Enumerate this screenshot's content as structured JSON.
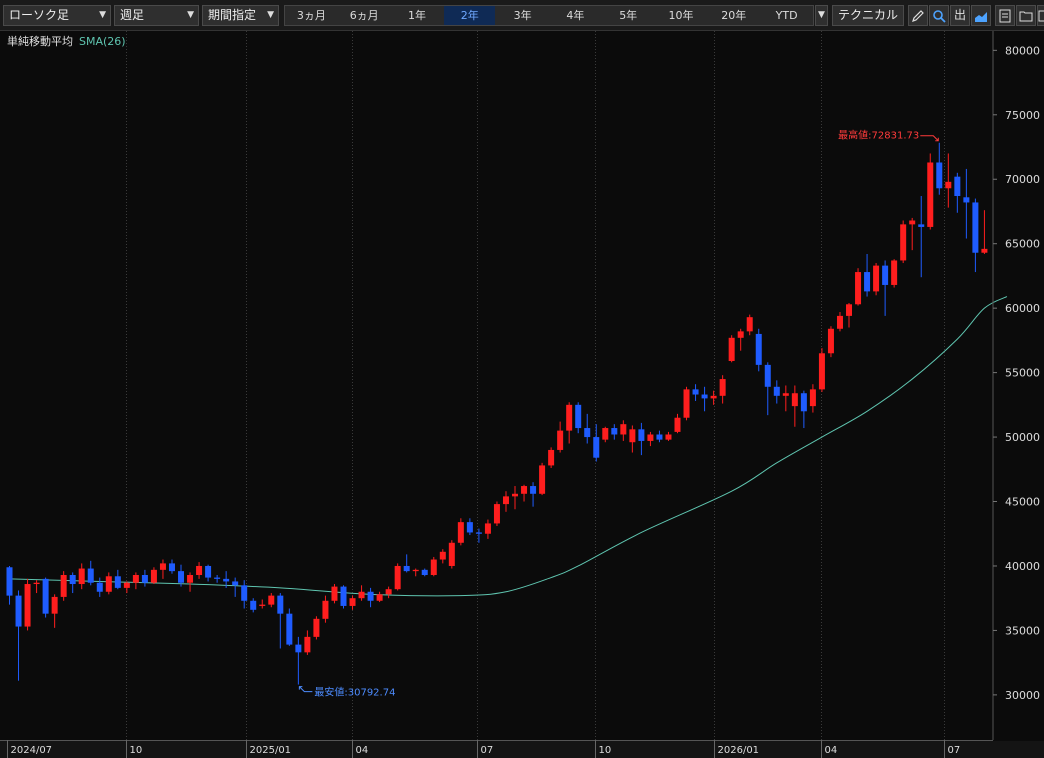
{
  "toolbar": {
    "chart_type": "ローソク足",
    "interval": "週足",
    "range_mode": "期間指定",
    "periods": [
      "3ヵ月",
      "6ヵ月",
      "1年",
      "2年",
      "3年",
      "4年",
      "5年",
      "10年",
      "20年",
      "YTD"
    ],
    "active_period": "2年",
    "technical_label": "テクニカル",
    "icons": [
      "pencil-icon",
      "zoom-icon",
      "export-icon",
      "chart-style-icon",
      "save-icon",
      "folder-icon",
      "window-icon"
    ],
    "export_glyph": "出"
  },
  "indicator": {
    "name": "単純移動平均",
    "param": "SMA(26)"
  },
  "colors": {
    "up": "#ff1e1e",
    "down": "#1f5cff",
    "sma": "#5fc5b0",
    "grid": "#3a3a3a",
    "background": "#0b0b0b"
  },
  "annotations": {
    "high_label": "最高値:72831.73",
    "high_value": 72831.73,
    "low_label": "最安値:30792.74",
    "low_value": 30792.74
  },
  "chart_data": {
    "type": "candlestick",
    "interval": "weekly",
    "ylim": [
      26500,
      81500
    ],
    "y_ticks": [
      30000,
      35000,
      40000,
      45000,
      50000,
      55000,
      60000,
      65000,
      70000,
      75000,
      80000
    ],
    "x_labels": [
      {
        "label": "2024/07",
        "week": 0
      },
      {
        "label": "10",
        "week": 13.2
      },
      {
        "label": "2025/01",
        "week": 26.5
      },
      {
        "label": "04",
        "week": 38.3
      },
      {
        "label": "07",
        "week": 52.1
      },
      {
        "label": "10",
        "week": 65.2
      },
      {
        "label": "2026/01",
        "week": 78.4
      },
      {
        "label": "04",
        "week": 90.2
      },
      {
        "label": "07",
        "week": 103.9
      }
    ],
    "candles": [
      [
        39900,
        40000,
        37000,
        37700
      ],
      [
        37700,
        38100,
        31100,
        35300
      ],
      [
        35300,
        39000,
        35000,
        38600
      ],
      [
        38600,
        38900,
        37900,
        38700
      ],
      [
        39000,
        39100,
        36000,
        36300
      ],
      [
        36300,
        37800,
        35200,
        37600
      ],
      [
        37600,
        39600,
        37300,
        39300
      ],
      [
        39300,
        39500,
        37900,
        38600
      ],
      [
        38600,
        40200,
        38200,
        39800
      ],
      [
        39800,
        40400,
        38500,
        38700
      ],
      [
        38700,
        39100,
        37600,
        38000
      ],
      [
        38000,
        39500,
        37800,
        39200
      ],
      [
        39200,
        39700,
        38200,
        38300
      ],
      [
        38300,
        38800,
        37900,
        38700
      ],
      [
        38700,
        39500,
        38200,
        39300
      ],
      [
        39300,
        39700,
        38400,
        38700
      ],
      [
        38700,
        39900,
        38600,
        39700
      ],
      [
        39700,
        40500,
        39000,
        40200
      ],
      [
        40200,
        40500,
        39400,
        39600
      ],
      [
        39600,
        40100,
        38400,
        38700
      ],
      [
        38700,
        39500,
        38000,
        39300
      ],
      [
        39300,
        40300,
        39000,
        40000
      ],
      [
        40000,
        40100,
        38800,
        39100
      ],
      [
        39100,
        39300,
        38700,
        39000
      ],
      [
        39000,
        39600,
        38300,
        38800
      ],
      [
        38800,
        39100,
        37600,
        38500
      ],
      [
        38500,
        38900,
        36700,
        37300
      ],
      [
        37300,
        37500,
        36400,
        36600
      ],
      [
        36900,
        37400,
        36700,
        37000
      ],
      [
        37000,
        37900,
        36800,
        37700
      ],
      [
        37700,
        37900,
        33600,
        36300
      ],
      [
        36300,
        36700,
        33800,
        33900
      ],
      [
        33900,
        34500,
        30800,
        33300
      ],
      [
        33300,
        35000,
        33100,
        34500
      ],
      [
        34500,
        36100,
        34300,
        35900
      ],
      [
        35900,
        37700,
        35600,
        37300
      ],
      [
        37300,
        38600,
        37100,
        38400
      ],
      [
        38400,
        38500,
        36700,
        36900
      ],
      [
        36900,
        37700,
        36600,
        37500
      ],
      [
        37500,
        38500,
        37300,
        38000
      ],
      [
        38000,
        38300,
        36800,
        37300
      ],
      [
        37300,
        38000,
        37200,
        37800
      ],
      [
        37800,
        38400,
        37500,
        38200
      ],
      [
        38200,
        40200,
        38100,
        40000
      ],
      [
        40000,
        40900,
        39500,
        39600
      ],
      [
        39600,
        39800,
        39200,
        39700
      ],
      [
        39700,
        39800,
        39200,
        39300
      ],
      [
        39300,
        40700,
        39200,
        40500
      ],
      [
        40500,
        41300,
        40200,
        41100
      ],
      [
        40000,
        42000,
        39800,
        41800
      ],
      [
        41800,
        43700,
        41600,
        43400
      ],
      [
        43400,
        43700,
        42400,
        42600
      ],
      [
        42600,
        42900,
        41800,
        42500
      ],
      [
        42500,
        43600,
        42100,
        43300
      ],
      [
        43300,
        45000,
        43100,
        44800
      ],
      [
        44800,
        45800,
        44200,
        45400
      ],
      [
        45400,
        46200,
        44400,
        45600
      ],
      [
        45600,
        46300,
        45000,
        46200
      ],
      [
        46200,
        46500,
        44600,
        45600
      ],
      [
        45600,
        48000,
        45500,
        47800
      ],
      [
        47800,
        49200,
        47600,
        49000
      ],
      [
        49000,
        51200,
        48800,
        50500
      ],
      [
        50500,
        52700,
        49500,
        52500
      ],
      [
        52500,
        52700,
        50300,
        50700
      ],
      [
        50700,
        51800,
        49500,
        50000
      ],
      [
        50000,
        51000,
        48100,
        48400
      ],
      [
        49800,
        50800,
        49600,
        50700
      ],
      [
        50700,
        51000,
        49800,
        50200
      ],
      [
        50200,
        51300,
        49700,
        51000
      ],
      [
        49600,
        50900,
        48800,
        50600
      ],
      [
        50600,
        51100,
        48600,
        49700
      ],
      [
        49700,
        50400,
        49300,
        50200
      ],
      [
        50200,
        50500,
        49600,
        49800
      ],
      [
        49800,
        50400,
        49700,
        50200
      ],
      [
        50400,
        51800,
        50300,
        51500
      ],
      [
        51500,
        53900,
        51300,
        53700
      ],
      [
        53700,
        54100,
        52800,
        53300
      ],
      [
        53300,
        53900,
        52000,
        53000
      ],
      [
        53000,
        53600,
        52500,
        53200
      ],
      [
        53200,
        54800,
        52600,
        54500
      ],
      [
        55900,
        57900,
        55800,
        57700
      ],
      [
        57700,
        58400,
        56700,
        58200
      ],
      [
        58200,
        59500,
        57900,
        59300
      ],
      [
        58000,
        58400,
        55100,
        55600
      ],
      [
        55600,
        55800,
        51700,
        53900
      ],
      [
        53900,
        54400,
        52600,
        53200
      ],
      [
        53200,
        54000,
        52000,
        53400
      ],
      [
        52400,
        54000,
        50800,
        53400
      ],
      [
        53400,
        53600,
        50700,
        52000
      ],
      [
        52400,
        54100,
        51900,
        53700
      ],
      [
        53700,
        56900,
        53500,
        56500
      ],
      [
        56500,
        58600,
        56200,
        58400
      ],
      [
        58400,
        59700,
        58200,
        59400
      ],
      [
        59400,
        60400,
        58500,
        60300
      ],
      [
        60300,
        63100,
        60200,
        62800
      ],
      [
        62800,
        64200,
        60900,
        61300
      ],
      [
        61300,
        63500,
        61000,
        63300
      ],
      [
        63300,
        63700,
        59400,
        61800
      ],
      [
        61800,
        63800,
        61600,
        63700
      ],
      [
        63700,
        66800,
        63500,
        66500
      ],
      [
        66500,
        67000,
        64500,
        66800
      ],
      [
        66500,
        68700,
        62400,
        66300
      ],
      [
        66300,
        72000,
        66100,
        71300
      ],
      [
        71300,
        72831.73,
        68800,
        69300
      ],
      [
        69300,
        72000,
        67800,
        69800
      ],
      [
        70200,
        70500,
        67400,
        68700
      ],
      [
        68600,
        70800,
        65400,
        68200
      ],
      [
        68200,
        68500,
        62800,
        64300
      ],
      [
        64300,
        67600,
        64200,
        64600
      ]
    ],
    "sma_series_name": "SMA(26)",
    "sma": [
      [
        0,
        39000
      ],
      [
        10,
        38800
      ],
      [
        20,
        38600
      ],
      [
        30,
        38300
      ],
      [
        40,
        37800
      ],
      [
        50,
        37700
      ],
      [
        55,
        38000
      ],
      [
        60,
        39100
      ],
      [
        63,
        40000
      ],
      [
        70,
        42600
      ],
      [
        80,
        45800
      ],
      [
        85,
        48000
      ],
      [
        90,
        50000
      ],
      [
        95,
        52000
      ],
      [
        100,
        54500
      ],
      [
        105,
        57600
      ],
      [
        108,
        60000
      ],
      [
        110.5,
        60900
      ]
    ],
    "grid": {
      "vertical_dotted": true,
      "horizontal": false
    },
    "axis_position": "right"
  }
}
